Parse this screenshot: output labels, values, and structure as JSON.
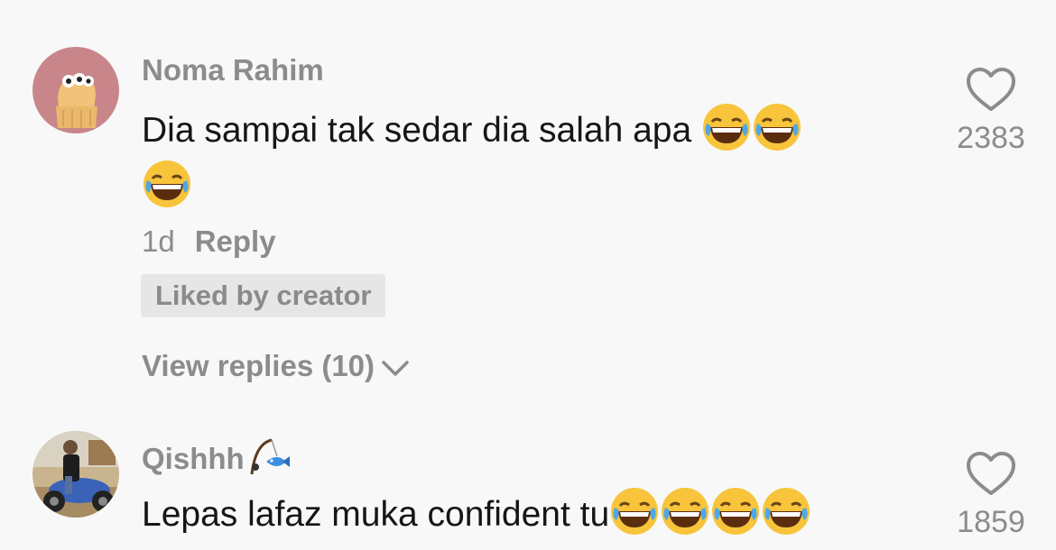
{
  "comments": [
    {
      "username": "Noma Rahim",
      "text": "Dia sampai tak sedar dia salah apa",
      "emoji_trailing": [
        "joy-emoji",
        "joy-emoji",
        "joy-emoji"
      ],
      "age": "1d",
      "reply_label": "Reply",
      "badge": "Liked by creator",
      "view_replies": "View replies (10)",
      "likes": "2383",
      "avatar": "cartoon-avatar",
      "avatar_bg": "#c9868a"
    },
    {
      "username": "Qishhh",
      "username_emoji": "fishing-pole-emoji",
      "text": "Lepas lafaz muka confident tu",
      "emoji_trailing": [
        "joy-emoji",
        "joy-emoji",
        "joy-emoji",
        "joy-emoji"
      ],
      "likes": "1859",
      "avatar": "motorbike-photo-avatar"
    }
  ],
  "colors": {
    "background": "#f8f8f8",
    "text": "#161616",
    "muted": "#8c8c8c",
    "badge_bg": "#e6e6e6"
  }
}
